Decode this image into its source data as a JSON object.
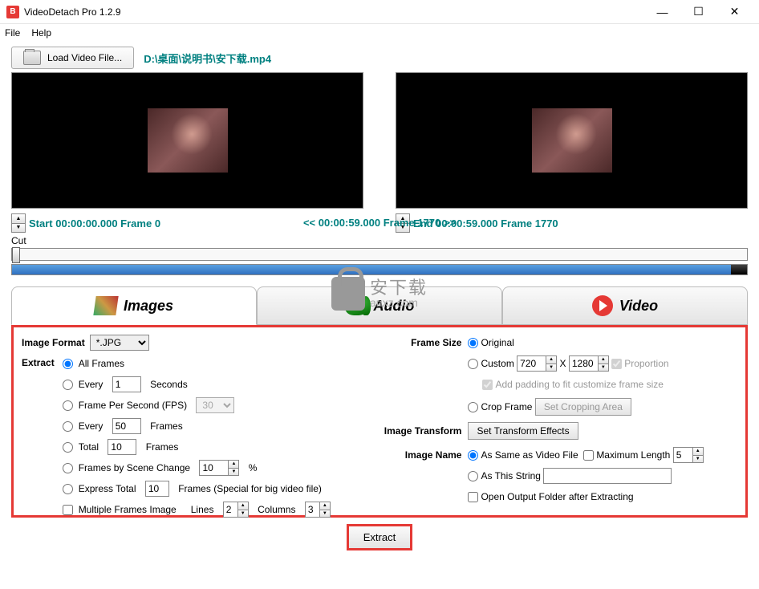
{
  "window": {
    "title": "VideoDetach Pro 1.2.9",
    "icon_letter": "B"
  },
  "menu": {
    "file": "File",
    "help": "Help"
  },
  "toolbar": {
    "load_label": "Load Video File..."
  },
  "file": {
    "path": "D:\\桌面\\说明书\\安下载.mp4"
  },
  "timeline": {
    "start_label": "Start 00:00:00.000  Frame 0",
    "center_label": "<< 00:00:59.000  Frame 1770 >>",
    "end_label": "End 00:00:59.000  Frame 1770",
    "cut_label": "Cut"
  },
  "watermark": {
    "cn": "安下载",
    "domain": "anxz.com"
  },
  "tabs": {
    "images": "Images",
    "audio": "Audio",
    "video": "Video"
  },
  "panel": {
    "image_format_label": "Image Format",
    "image_format_value": "*.JPG",
    "extract_label": "Extract",
    "all_frames": "All Frames",
    "every": "Every",
    "seconds": "Seconds",
    "fps_label": "Frame Per Second (FPS)",
    "fps_value": "30",
    "frames": "Frames",
    "total": "Total",
    "scene_change": "Frames by Scene Change",
    "pct": "%",
    "express_total": "Express Total",
    "express_tail": "Frames (Special for big video file)",
    "multi_frames": "Multiple Frames Image",
    "lines_label": "Lines",
    "lines_val": "2",
    "cols_label": "Columns",
    "cols_val": "3",
    "every_sec_val": "1",
    "every_frames_val": "50",
    "total_val": "10",
    "scene_val": "10",
    "express_val": "10",
    "frame_size_label": "Frame Size",
    "original": "Original",
    "custom": "Custom",
    "w_val": "720",
    "x": "X",
    "h_val": "1280",
    "proportion": "Proportion",
    "padding": "Add padding to fit customize frame size",
    "crop": "Crop Frame",
    "crop_btn": "Set Cropping Area",
    "transform_label": "Image Transform",
    "transform_btn": "Set Transform Effects",
    "name_label": "Image Name",
    "name_same": "As Same as Video File",
    "max_len": "Maximum Length",
    "max_len_val": "5",
    "as_string": "As This String",
    "open_folder": "Open Output Folder after Extracting"
  },
  "extract_button": "Extract"
}
